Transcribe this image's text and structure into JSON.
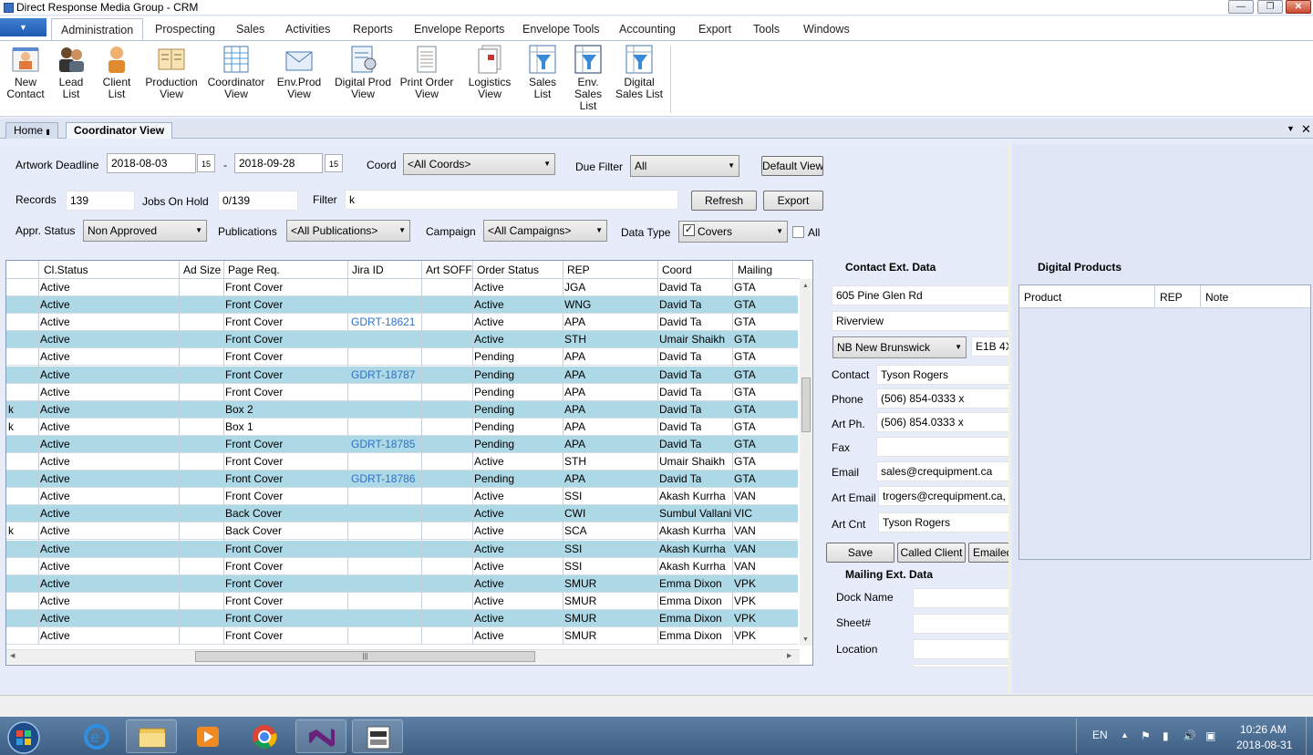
{
  "window": {
    "title": "Direct Response Media Group - CRM"
  },
  "ribbon": {
    "tabs": [
      "Administration",
      "Prospecting",
      "Sales",
      "Activities",
      "Reports",
      "Envelope Reports",
      "Envelope Tools",
      "Accounting",
      "Export",
      "Tools",
      "Windows"
    ],
    "buttons": [
      {
        "label": "New\nContact",
        "icon": "new-contact-icon"
      },
      {
        "label": "Lead\nList",
        "icon": "lead-list-icon"
      },
      {
        "label": "Client\nList",
        "icon": "client-list-icon"
      },
      {
        "label": "Production\nView",
        "icon": "production-view-icon"
      },
      {
        "label": "Coordinator\nView",
        "icon": "coordinator-view-icon"
      },
      {
        "label": "Env.Prod\nView",
        "icon": "env-prod-view-icon"
      },
      {
        "label": "Digital Prod\nView",
        "icon": "digital-prod-view-icon"
      },
      {
        "label": "Print Order\nView",
        "icon": "print-order-view-icon"
      },
      {
        "label": "Logistics\nView",
        "icon": "logistics-view-icon"
      },
      {
        "label": "Sales\nList",
        "icon": "sales-list-icon"
      },
      {
        "label": "Env.\nSales List",
        "icon": "env-sales-list-icon"
      },
      {
        "label": "Digital\nSales List",
        "icon": "digital-sales-list-icon"
      }
    ]
  },
  "doc_tabs": {
    "home": "Home",
    "current": "Coordinator View"
  },
  "filters": {
    "artwork_deadline_label": "Artwork Deadline",
    "date_from": "2018-08-03",
    "date_sep": "-",
    "date_to": "2018-09-28",
    "calendar_day": "15",
    "coord_label": "Coord",
    "coord_value": "<All Coords>",
    "due_filter_label": "Due Filter",
    "due_filter_value": "All",
    "default_view_button": "Default View",
    "records_label": "Records",
    "records_value": "139",
    "jobs_on_hold_label": "Jobs On Hold",
    "jobs_on_hold_value": "0/139",
    "filter_label": "Filter",
    "filter_value": "k",
    "refresh_button": "Refresh",
    "export_button": "Export",
    "appr_status_label": "Appr. Status",
    "appr_status_value": "Non Approved",
    "publications_label": "Publications",
    "publications_value": "<All Publications>",
    "campaign_label": "Campaign",
    "campaign_value": "<All Campaigns>",
    "data_type_label": "Data Type",
    "data_type_value": "Covers",
    "data_type_checked": true,
    "all_label": "All",
    "all_checked": false
  },
  "grid": {
    "columns": [
      "Cl.Status",
      "Ad Size",
      "Page Req.",
      "Jira ID",
      "Art SOFF",
      "Order Status",
      "REP",
      "Coord",
      "Mailing"
    ],
    "rows": [
      {
        "pre": "",
        "status": "Active",
        "ad": "",
        "page": "Front Cover",
        "jira": "",
        "soff": "",
        "order": "Active",
        "rep": "JGA",
        "coord": "David Ta",
        "mail": "GTA"
      },
      {
        "pre": "",
        "status": "Active",
        "ad": "",
        "page": "Front Cover",
        "jira": "",
        "soff": "",
        "order": "Active",
        "rep": "WNG",
        "coord": "David Ta",
        "mail": "GTA"
      },
      {
        "pre": "",
        "status": "Active",
        "ad": "",
        "page": "Front Cover",
        "jira": "GDRT-18621",
        "soff": "",
        "order": "Active",
        "rep": "APA",
        "coord": "David Ta",
        "mail": "GTA"
      },
      {
        "pre": "",
        "status": "Active",
        "ad": "",
        "page": "Front Cover",
        "jira": "",
        "soff": "",
        "order": "Active",
        "rep": "STH",
        "coord": "Umair Shaikh",
        "mail": "GTA"
      },
      {
        "pre": "",
        "status": "Active",
        "ad": "",
        "page": "Front Cover",
        "jira": "",
        "soff": "",
        "order": "Pending",
        "rep": "APA",
        "coord": "David Ta",
        "mail": "GTA"
      },
      {
        "pre": "",
        "status": "Active",
        "ad": "",
        "page": "Front Cover",
        "jira": "GDRT-18787",
        "soff": "",
        "order": "Pending",
        "rep": "APA",
        "coord": "David Ta",
        "mail": "GTA"
      },
      {
        "pre": "",
        "status": "Active",
        "ad": "",
        "page": "Front Cover",
        "jira": "",
        "soff": "",
        "order": "Pending",
        "rep": "APA",
        "coord": "David Ta",
        "mail": "GTA"
      },
      {
        "pre": "k",
        "status": "Active",
        "ad": "",
        "page": "Box 2",
        "jira": "",
        "soff": "",
        "order": "Pending",
        "rep": "APA",
        "coord": "David Ta",
        "mail": "GTA"
      },
      {
        "pre": "k",
        "status": "Active",
        "ad": "",
        "page": "Box 1",
        "jira": "",
        "soff": "",
        "order": "Pending",
        "rep": "APA",
        "coord": "David Ta",
        "mail": "GTA"
      },
      {
        "pre": "",
        "status": "Active",
        "ad": "",
        "page": "Front Cover",
        "jira": "GDRT-18785",
        "soff": "",
        "order": "Pending",
        "rep": "APA",
        "coord": "David Ta",
        "mail": "GTA"
      },
      {
        "pre": "",
        "status": "Active",
        "ad": "",
        "page": "Front Cover",
        "jira": "",
        "soff": "",
        "order": "Active",
        "rep": "STH",
        "coord": "Umair Shaikh",
        "mail": "GTA"
      },
      {
        "pre": "",
        "status": "Active",
        "ad": "",
        "page": "Front Cover",
        "jira": "GDRT-18786",
        "soff": "",
        "order": "Pending",
        "rep": "APA",
        "coord": "David Ta",
        "mail": "GTA"
      },
      {
        "pre": "",
        "status": "Active",
        "ad": "",
        "page": "Front Cover",
        "jira": "",
        "soff": "",
        "order": "Active",
        "rep": "SSI",
        "coord": "Akash Kurrha",
        "mail": "VAN"
      },
      {
        "pre": "",
        "status": "Active",
        "ad": "",
        "page": "Back Cover",
        "jira": "",
        "soff": "",
        "order": "Active",
        "rep": "CWI",
        "coord": "Sumbul Vallani",
        "mail": "VIC"
      },
      {
        "pre": "k",
        "status": "Active",
        "ad": "",
        "page": "Back Cover",
        "jira": "",
        "soff": "",
        "order": "Active",
        "rep": "SCA",
        "coord": "Akash Kurrha",
        "mail": "VAN"
      },
      {
        "pre": "",
        "status": "Active",
        "ad": "",
        "page": "Front Cover",
        "jira": "",
        "soff": "",
        "order": "Active",
        "rep": "SSI",
        "coord": "Akash Kurrha",
        "mail": "VAN"
      },
      {
        "pre": "",
        "status": "Active",
        "ad": "",
        "page": "Front Cover",
        "jira": "",
        "soff": "",
        "order": "Active",
        "rep": "SSI",
        "coord": "Akash Kurrha",
        "mail": "VAN"
      },
      {
        "pre": "",
        "status": "Active",
        "ad": "",
        "page": "Front Cover",
        "jira": "",
        "soff": "",
        "order": "Active",
        "rep": "SMUR",
        "coord": "Emma Dixon",
        "mail": "VPK"
      },
      {
        "pre": "",
        "status": "Active",
        "ad": "",
        "page": "Front Cover",
        "jira": "",
        "soff": "",
        "order": "Active",
        "rep": "SMUR",
        "coord": "Emma Dixon",
        "mail": "VPK"
      },
      {
        "pre": "",
        "status": "Active",
        "ad": "",
        "page": "Front Cover",
        "jira": "",
        "soff": "",
        "order": "Active",
        "rep": "SMUR",
        "coord": "Emma Dixon",
        "mail": "VPK"
      },
      {
        "pre": "",
        "status": "Active",
        "ad": "",
        "page": "Front Cover",
        "jira": "",
        "soff": "",
        "order": "Active",
        "rep": "SMUR",
        "coord": "Emma Dixon",
        "mail": "VPK"
      }
    ]
  },
  "contact": {
    "title": "Contact Ext. Data",
    "address1": "605 Pine Glen Rd",
    "address2": "Riverview",
    "province": "NB New Brunswick",
    "postal": "E1B 4X",
    "contact_label": "Contact",
    "contact_value": "Tyson Rogers",
    "phone_label": "Phone",
    "phone_value": "(506) 854-0333 x",
    "art_ph_label": "Art Ph.",
    "art_ph_value": "(506) 854.0333 x",
    "fax_label": "Fax",
    "fax_value": "",
    "email_label": "Email",
    "email_value": "sales@crequipment.ca",
    "art_email_label": "Art Email",
    "art_email_value": "trogers@crequipment.ca,",
    "art_cnt_label": "Art Cnt",
    "art_cnt_value": "Tyson Rogers",
    "save_button": "Save",
    "called_client_button": "Called Client",
    "emailed_button": "Emailed"
  },
  "mailing": {
    "title": "Mailing Ext. Data",
    "dock_name_label": "Dock Name",
    "sheet_label": "Sheet#",
    "location_label": "Location"
  },
  "digital": {
    "title": "Digital Products",
    "columns": [
      "Product",
      "REP",
      "Note"
    ]
  },
  "taskbar": {
    "lang": "EN",
    "time": "10:26 AM",
    "date": "2018-08-31"
  },
  "colors": {
    "row_alt": "#add8e6",
    "link": "#2e72c7",
    "taskbar": "#4a6b8f"
  }
}
